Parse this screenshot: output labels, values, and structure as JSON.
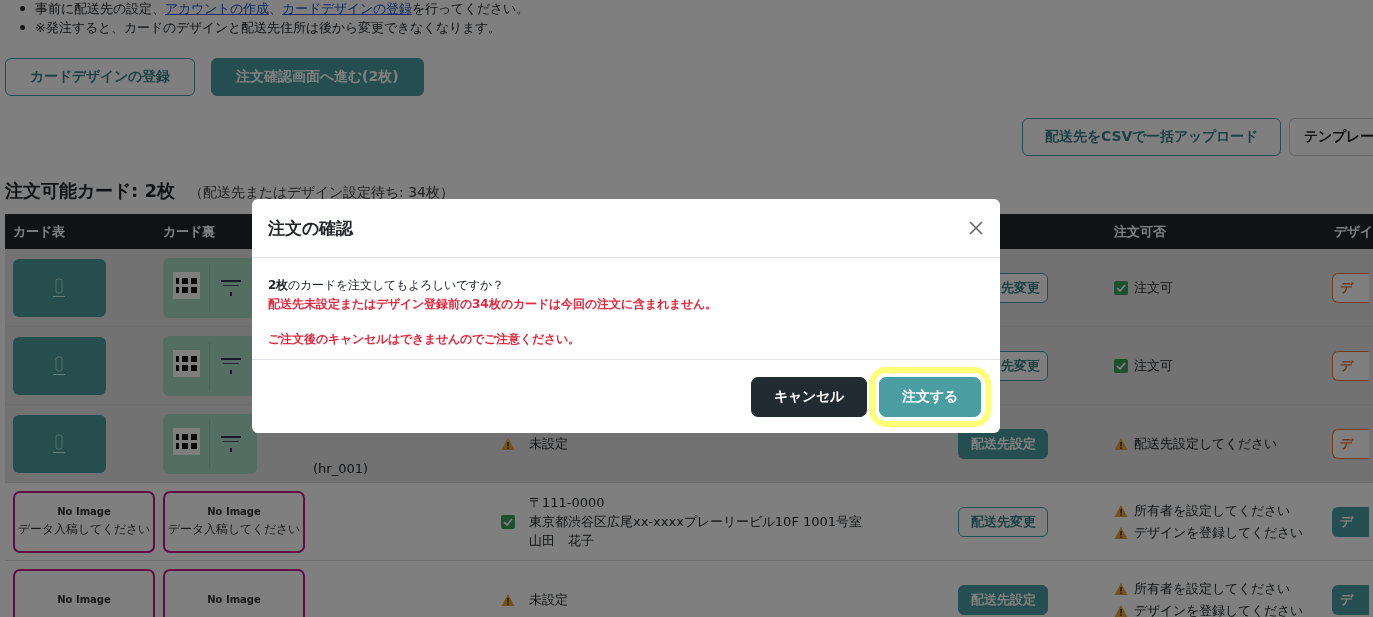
{
  "notes": [
    {
      "parts": [
        {
          "text": "事前に配送先の設定、"
        },
        {
          "text": "アカウントの作成",
          "kind": "link"
        },
        {
          "text": "、"
        },
        {
          "text": "カードデザインの登録",
          "kind": "link"
        },
        {
          "text": "を行ってください。"
        }
      ]
    },
    {
      "parts": [
        {
          "text": "※発注すると、カードのデザインと配送先住所は後から変更できなくなります。"
        }
      ]
    }
  ],
  "actions": [
    {
      "label": "カードデザインの登録",
      "kind": "outline"
    },
    {
      "label": "注文確認画面へ進む(2枚)",
      "kind": "primary"
    }
  ],
  "upload_actions": [
    {
      "label": "配送先をCSVで一括アップロード",
      "kind": "outline"
    },
    {
      "label": "テンプレー",
      "kind": "plain"
    }
  ],
  "summary": {
    "title": "注文可能カード: 2枚",
    "note": "（配送先またはデザイン設定待ち: 34枚）"
  },
  "table": {
    "header": {
      "front": "カード表",
      "back": "カード裏",
      "orderable": "注文可否",
      "design": "デザイ"
    },
    "rows": [
      {
        "shaded": true,
        "front": {
          "kind": "image"
        },
        "back": {
          "kind": "image"
        },
        "address_button": {
          "label": "先変更",
          "kind": "outline"
        },
        "status": [
          {
            "kind": "ok",
            "text": "注文可"
          }
        ],
        "design_button": {
          "label": "デ",
          "kind": "outline"
        }
      },
      {
        "shaded": true,
        "front": {
          "kind": "image"
        },
        "back": {
          "kind": "image"
        },
        "address_button": {
          "label": "先変更",
          "kind": "outline"
        },
        "status": [
          {
            "kind": "ok",
            "text": "注文可"
          }
        ],
        "design_button": {
          "label": "デ",
          "kind": "outline"
        }
      },
      {
        "shaded": true,
        "front": {
          "kind": "image"
        },
        "back": {
          "kind": "image"
        },
        "code": "(hr_001)",
        "address": {
          "kind": "warning",
          "lines": [
            "未設定"
          ]
        },
        "address_button": {
          "label": "配送先設定",
          "kind": "filled"
        },
        "status": [
          {
            "kind": "warning",
            "text": "配送先設定してください"
          }
        ],
        "design_button": {
          "label": "デ",
          "kind": "outline"
        }
      },
      {
        "shaded": false,
        "front": {
          "kind": "no_image",
          "title": "No Image",
          "note": "データ入稿してください"
        },
        "back": {
          "kind": "no_image",
          "title": "No Image",
          "note": "データ入稿してください"
        },
        "address": {
          "kind": "ok",
          "lines": [
            "〒111-0000",
            "東京都渋谷区広尾xx-xxxxプレーリービル10F 1001号室",
            "山田　花子"
          ]
        },
        "address_button": {
          "label": "配送先変更",
          "kind": "outline"
        },
        "status": [
          {
            "kind": "warning",
            "text": "所有者を設定してください"
          },
          {
            "kind": "warning",
            "text": "デザインを登録してください"
          }
        ],
        "design_button": {
          "label": "デ",
          "kind": "filled"
        }
      },
      {
        "shaded": false,
        "front": {
          "kind": "no_image",
          "title": "No Image"
        },
        "back": {
          "kind": "no_image",
          "title": "No Image"
        },
        "address": {
          "kind": "warning",
          "lines": [
            "未設定"
          ]
        },
        "address_button": {
          "label": "配送先設定",
          "kind": "filled"
        },
        "status": [
          {
            "kind": "warning",
            "text": "所有者を設定してください"
          },
          {
            "kind": "warning",
            "text": "デザインを登録してください"
          }
        ],
        "design_button": {
          "label": "デ",
          "kind": "filled"
        }
      }
    ]
  },
  "modal": {
    "title": "注文の確認",
    "message": "**2枚**のカードを注文してもよろしいですか？",
    "warnings": [
      "配送先未設定またはデザイン登録前の34枚のカードは今回の注文に含まれません。",
      "ご注文後のキャンセルはできませんのでご注意ください。"
    ],
    "buttons": [
      {
        "label": "キャンセル",
        "kind": "secondary",
        "highlighted": false
      },
      {
        "label": "注文する",
        "kind": "primary",
        "highlighted": true
      }
    ]
  }
}
